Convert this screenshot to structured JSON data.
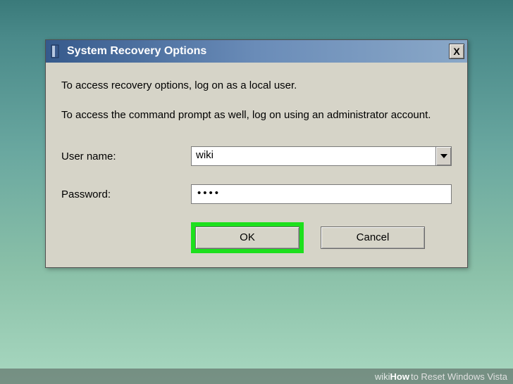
{
  "dialog": {
    "title": "System Recovery Options",
    "close_label": "X",
    "instruction1": "To access recovery options, log on as a local user.",
    "instruction2": "To access the command prompt as well, log on using an administrator account.",
    "username_label": "User name:",
    "username_value": "wiki",
    "password_label": "Password:",
    "password_mask": "••••",
    "ok_label": "OK",
    "cancel_label": "Cancel"
  },
  "watermark": {
    "wiki": "wiki",
    "how": "How",
    "rest": " to Reset Windows Vista"
  }
}
